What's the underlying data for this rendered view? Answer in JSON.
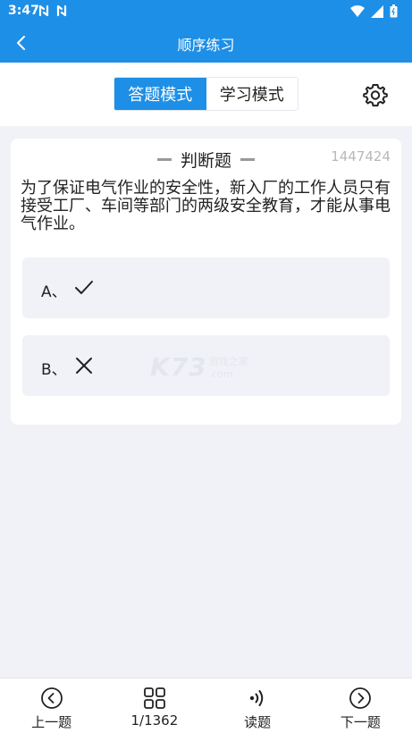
{
  "status_bar": {
    "time": "3:47"
  },
  "nav": {
    "title": "顺序练习"
  },
  "mode": {
    "answer_mode": "答题模式",
    "study_mode": "学习模式"
  },
  "question": {
    "type_label": "判断题",
    "id": "1447424",
    "text": "为了保证电气作业的安全性，新入厂的工作人员只有接受工厂、车间等部门的两级安全教育，才能从事电气作业。",
    "options": [
      {
        "letter": "A、",
        "icon": "check-icon"
      },
      {
        "letter": "B、",
        "icon": "cross-icon"
      }
    ]
  },
  "watermark": {
    "brand": "K73",
    "cn": "游戏之家",
    "domain": ".com"
  },
  "bottom": {
    "prev_label": "上一题",
    "progress_label": "1/1362",
    "read_label": "读题",
    "next_label": "下一题"
  },
  "colors": {
    "accent": "#1e8fe6",
    "background": "#f1f2f7",
    "option_bg": "#f1f2f7"
  }
}
